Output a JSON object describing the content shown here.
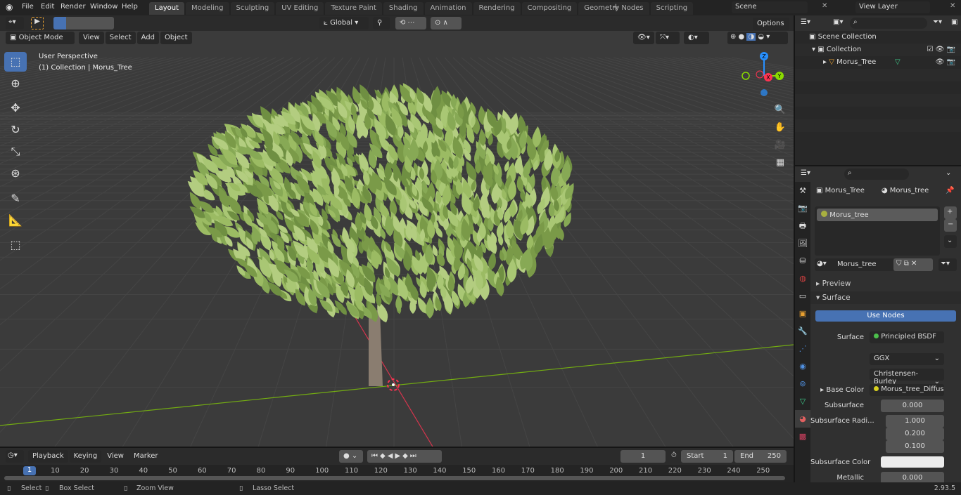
{
  "menus": [
    "File",
    "Edit",
    "Render",
    "Window",
    "Help"
  ],
  "workspaces": [
    {
      "label": "Layout",
      "active": true
    },
    {
      "label": "Modeling"
    },
    {
      "label": "Sculpting"
    },
    {
      "label": "UV Editing"
    },
    {
      "label": "Texture Paint"
    },
    {
      "label": "Shading"
    },
    {
      "label": "Animation"
    },
    {
      "label": "Rendering"
    },
    {
      "label": "Compositing"
    },
    {
      "label": "Geometry Nodes"
    },
    {
      "label": "Scripting"
    }
  ],
  "scene": "Scene",
  "view_layer": "View Layer",
  "viewport": {
    "mode": "Object Mode",
    "menus": [
      "View",
      "Select",
      "Add",
      "Object"
    ],
    "orientation": "Global",
    "options": "Options",
    "info_line1": "User Perspective",
    "info_line2": "(1) Collection | Morus_Tree",
    "gizmo": {
      "z": "Z",
      "y": "Y",
      "x": "X"
    }
  },
  "outliner": {
    "root": "Scene Collection",
    "collection": "Collection",
    "object": "Morus_Tree"
  },
  "properties": {
    "object": "Morus_Tree",
    "material": "Morus_tree",
    "slot": "Morus_tree",
    "material_name": "Morus_tree",
    "preview": "Preview",
    "surface_panel": "Surface",
    "use_nodes": "Use Nodes",
    "fields": {
      "surface_label": "Surface",
      "surface_value": "Principled BSDF",
      "distribution": "GGX",
      "subsurface_method": "Christensen-Burley",
      "base_color_label": "Base Color",
      "base_color_value": "Morus_tree_Diffuse...",
      "subsurface_label": "Subsurface",
      "subsurface_value": "0.000",
      "radius_label": "Subsurface Radi...",
      "radius": [
        "1.000",
        "0.200",
        "0.100"
      ],
      "ss_color_label": "Subsurface Color",
      "metallic_label": "Metallic",
      "metallic_value": "0.000"
    }
  },
  "timeline": {
    "menus": [
      "Playback",
      "Keying",
      "View",
      "Marker"
    ],
    "current_frame": "1",
    "start_label": "Start",
    "start": "1",
    "end_label": "End",
    "end": "250",
    "ticks": [
      "10",
      "20",
      "30",
      "40",
      "50",
      "60",
      "70",
      "80",
      "90",
      "100",
      "110",
      "120",
      "130",
      "140",
      "150",
      "160",
      "170",
      "180",
      "190",
      "200",
      "210",
      "220",
      "230",
      "240",
      "250"
    ],
    "playhead": "1"
  },
  "status": {
    "select": "Select",
    "box_select": "Box Select",
    "zoom_view": "Zoom View",
    "lasso_select": "Lasso Select",
    "version": "2.93.5"
  },
  "colors": {
    "accent": "#4772b3",
    "leaf": "#8fb25a",
    "x_axis": "#ff3352",
    "y_axis": "#8bdc00",
    "z_axis": "#2890ff"
  }
}
